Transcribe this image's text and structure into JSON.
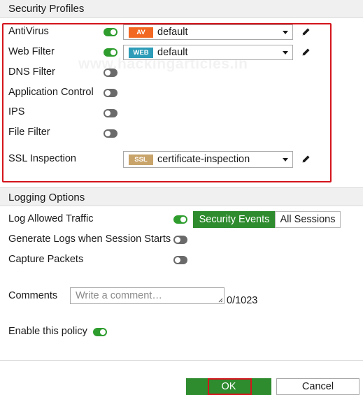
{
  "security_profiles": {
    "title": "Security Profiles",
    "rows": [
      {
        "label": "AntiVirus",
        "enabled": true,
        "badge": "AV",
        "badge_color": "#f26722",
        "value": "default"
      },
      {
        "label": "Web Filter",
        "enabled": true,
        "badge": "WEB",
        "badge_color": "#2c9cb8",
        "value": "default"
      },
      {
        "label": "DNS Filter",
        "enabled": false
      },
      {
        "label": "Application Control",
        "enabled": false
      },
      {
        "label": "IPS",
        "enabled": false
      },
      {
        "label": "File Filter",
        "enabled": false
      },
      {
        "label": "SSL Inspection",
        "badge": "SSL",
        "badge_color": "#c8a36a",
        "value": "certificate-inspection"
      }
    ]
  },
  "logging_options": {
    "title": "Logging Options",
    "log_allowed_traffic": {
      "label": "Log Allowed Traffic",
      "enabled": true
    },
    "segments": {
      "security_events": "Security Events",
      "all_sessions": "All Sessions",
      "selected": "Security Events"
    },
    "generate_logs": {
      "label": "Generate Logs when Session Starts",
      "enabled": false
    },
    "capture_packets": {
      "label": "Capture Packets",
      "enabled": false
    }
  },
  "comments": {
    "label": "Comments",
    "placeholder": "Write a comment…",
    "count": "0/1023"
  },
  "enable_policy": {
    "label": "Enable this policy",
    "enabled": true
  },
  "buttons": {
    "ok": "OK",
    "cancel": "Cancel"
  },
  "watermark": "www.hackingarticles.in",
  "colors": {
    "toggle_on": "#2e9d2e",
    "toggle_off": "#6a6a6a",
    "ok_button": "#2e8b2e",
    "highlight": "#d4141c"
  }
}
